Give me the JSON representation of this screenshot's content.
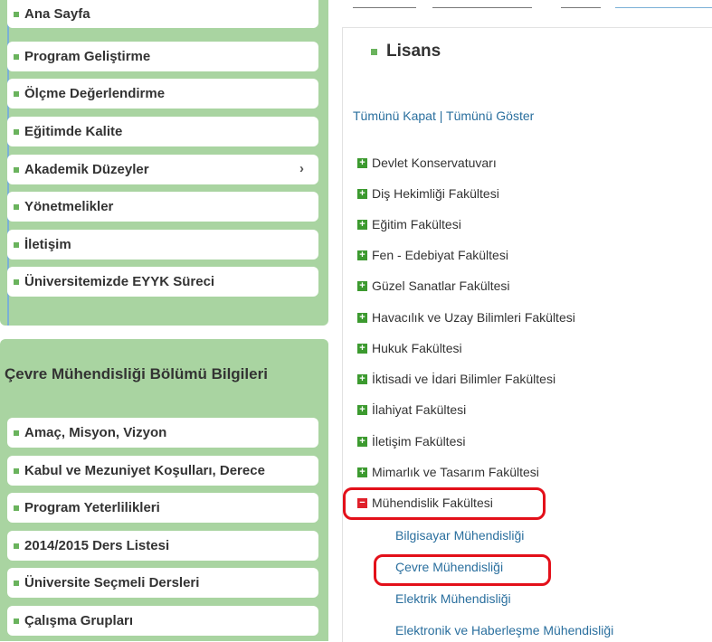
{
  "sidebar": {
    "items": [
      {
        "label": "Ana Sayfa"
      },
      {
        "label": "Program Geliştirme"
      },
      {
        "label": "Ölçme Değerlendirme"
      },
      {
        "label": "Eğitimde Kalite"
      },
      {
        "label": "Akademik Düzeyler",
        "chevron": "›"
      },
      {
        "label": "Yönetmelikler"
      },
      {
        "label": "İletişim"
      },
      {
        "label": "Üniversitemizde EYYK Süreci"
      }
    ],
    "section_title": "Çevre Mühendisliği Bölümü Bilgileri",
    "section_items": [
      {
        "label": "Amaç, Misyon, Vizyon"
      },
      {
        "label": "Kabul ve Mezuniyet Koşulları, Derece"
      },
      {
        "label": "Program Yeterlilikleri"
      },
      {
        "label": "2014/2015 Ders Listesi"
      },
      {
        "label": "Üniversite Seçmeli Dersleri"
      },
      {
        "label": "Çalışma Grupları"
      }
    ]
  },
  "main": {
    "title": "Lisans",
    "collapse_all": "Tümünü Kapat",
    "separator": "|",
    "expand_all": "Tümünü Göster",
    "tree": [
      {
        "label": "Devlet Konservatuvarı",
        "icon": "+"
      },
      {
        "label": "Diş Hekimliği Fakültesi",
        "icon": "+"
      },
      {
        "label": "Eğitim Fakültesi",
        "icon": "+"
      },
      {
        "label": "Fen - Edebiyat Fakültesi",
        "icon": "+"
      },
      {
        "label": "Güzel Sanatlar Fakültesi",
        "icon": "+"
      },
      {
        "label": "Havacılık ve Uzay Bilimleri Fakültesi",
        "icon": "+"
      },
      {
        "label": "Hukuk Fakültesi",
        "icon": "+"
      },
      {
        "label": "İktisadi ve İdari Bilimler Fakültesi",
        "icon": "+"
      },
      {
        "label": "İlahiyat Fakültesi",
        "icon": "+"
      },
      {
        "label": "İletişim Fakültesi",
        "icon": "+"
      },
      {
        "label": "Mimarlık ve Tasarım Fakültesi",
        "icon": "+"
      },
      {
        "label": "Mühendislik Fakültesi",
        "icon": "−"
      }
    ],
    "sub_items": [
      {
        "label": "Bilgisayar Mühendisliği"
      },
      {
        "label": "Çevre Mühendisliği"
      },
      {
        "label": "Elektrik Mühendisliği"
      },
      {
        "label": "Elektronik ve Haberleşme Mühendisliği"
      }
    ]
  },
  "colors": {
    "sidebar_bg": "#a9d4a1",
    "bullet": "#6ab35d",
    "link": "#2a6f9e",
    "plus_icon": "#3c9a2f",
    "minus_icon": "#e0202a",
    "highlight": "#e3101a"
  }
}
